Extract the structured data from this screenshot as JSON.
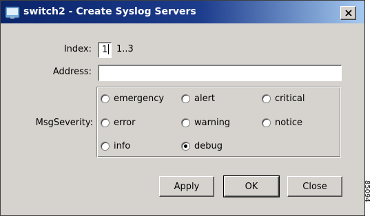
{
  "window": {
    "title": "switch2 - Create Syslog Servers",
    "icon": "app-window-icon",
    "close_icon": "close-x-icon"
  },
  "form": {
    "index_label": "Index:",
    "index_value": "1",
    "index_range": "1..3",
    "address_label": "Address:",
    "address_value": "",
    "severity_label": "MsgSeverity:",
    "severity_options": [
      {
        "label": "emergency",
        "checked": false
      },
      {
        "label": "alert",
        "checked": false
      },
      {
        "label": "critical",
        "checked": false
      },
      {
        "label": "error",
        "checked": false
      },
      {
        "label": "warning",
        "checked": false
      },
      {
        "label": "notice",
        "checked": false
      },
      {
        "label": "info",
        "checked": false
      },
      {
        "label": "debug",
        "checked": true
      }
    ]
  },
  "buttons": {
    "apply": "Apply",
    "ok": "OK",
    "close": "Close"
  },
  "figure_code": "85094",
  "colors": {
    "title_bar_start": "#0a246a",
    "title_bar_end": "#a6caf0",
    "dialog_background": "#d6d3ce"
  }
}
